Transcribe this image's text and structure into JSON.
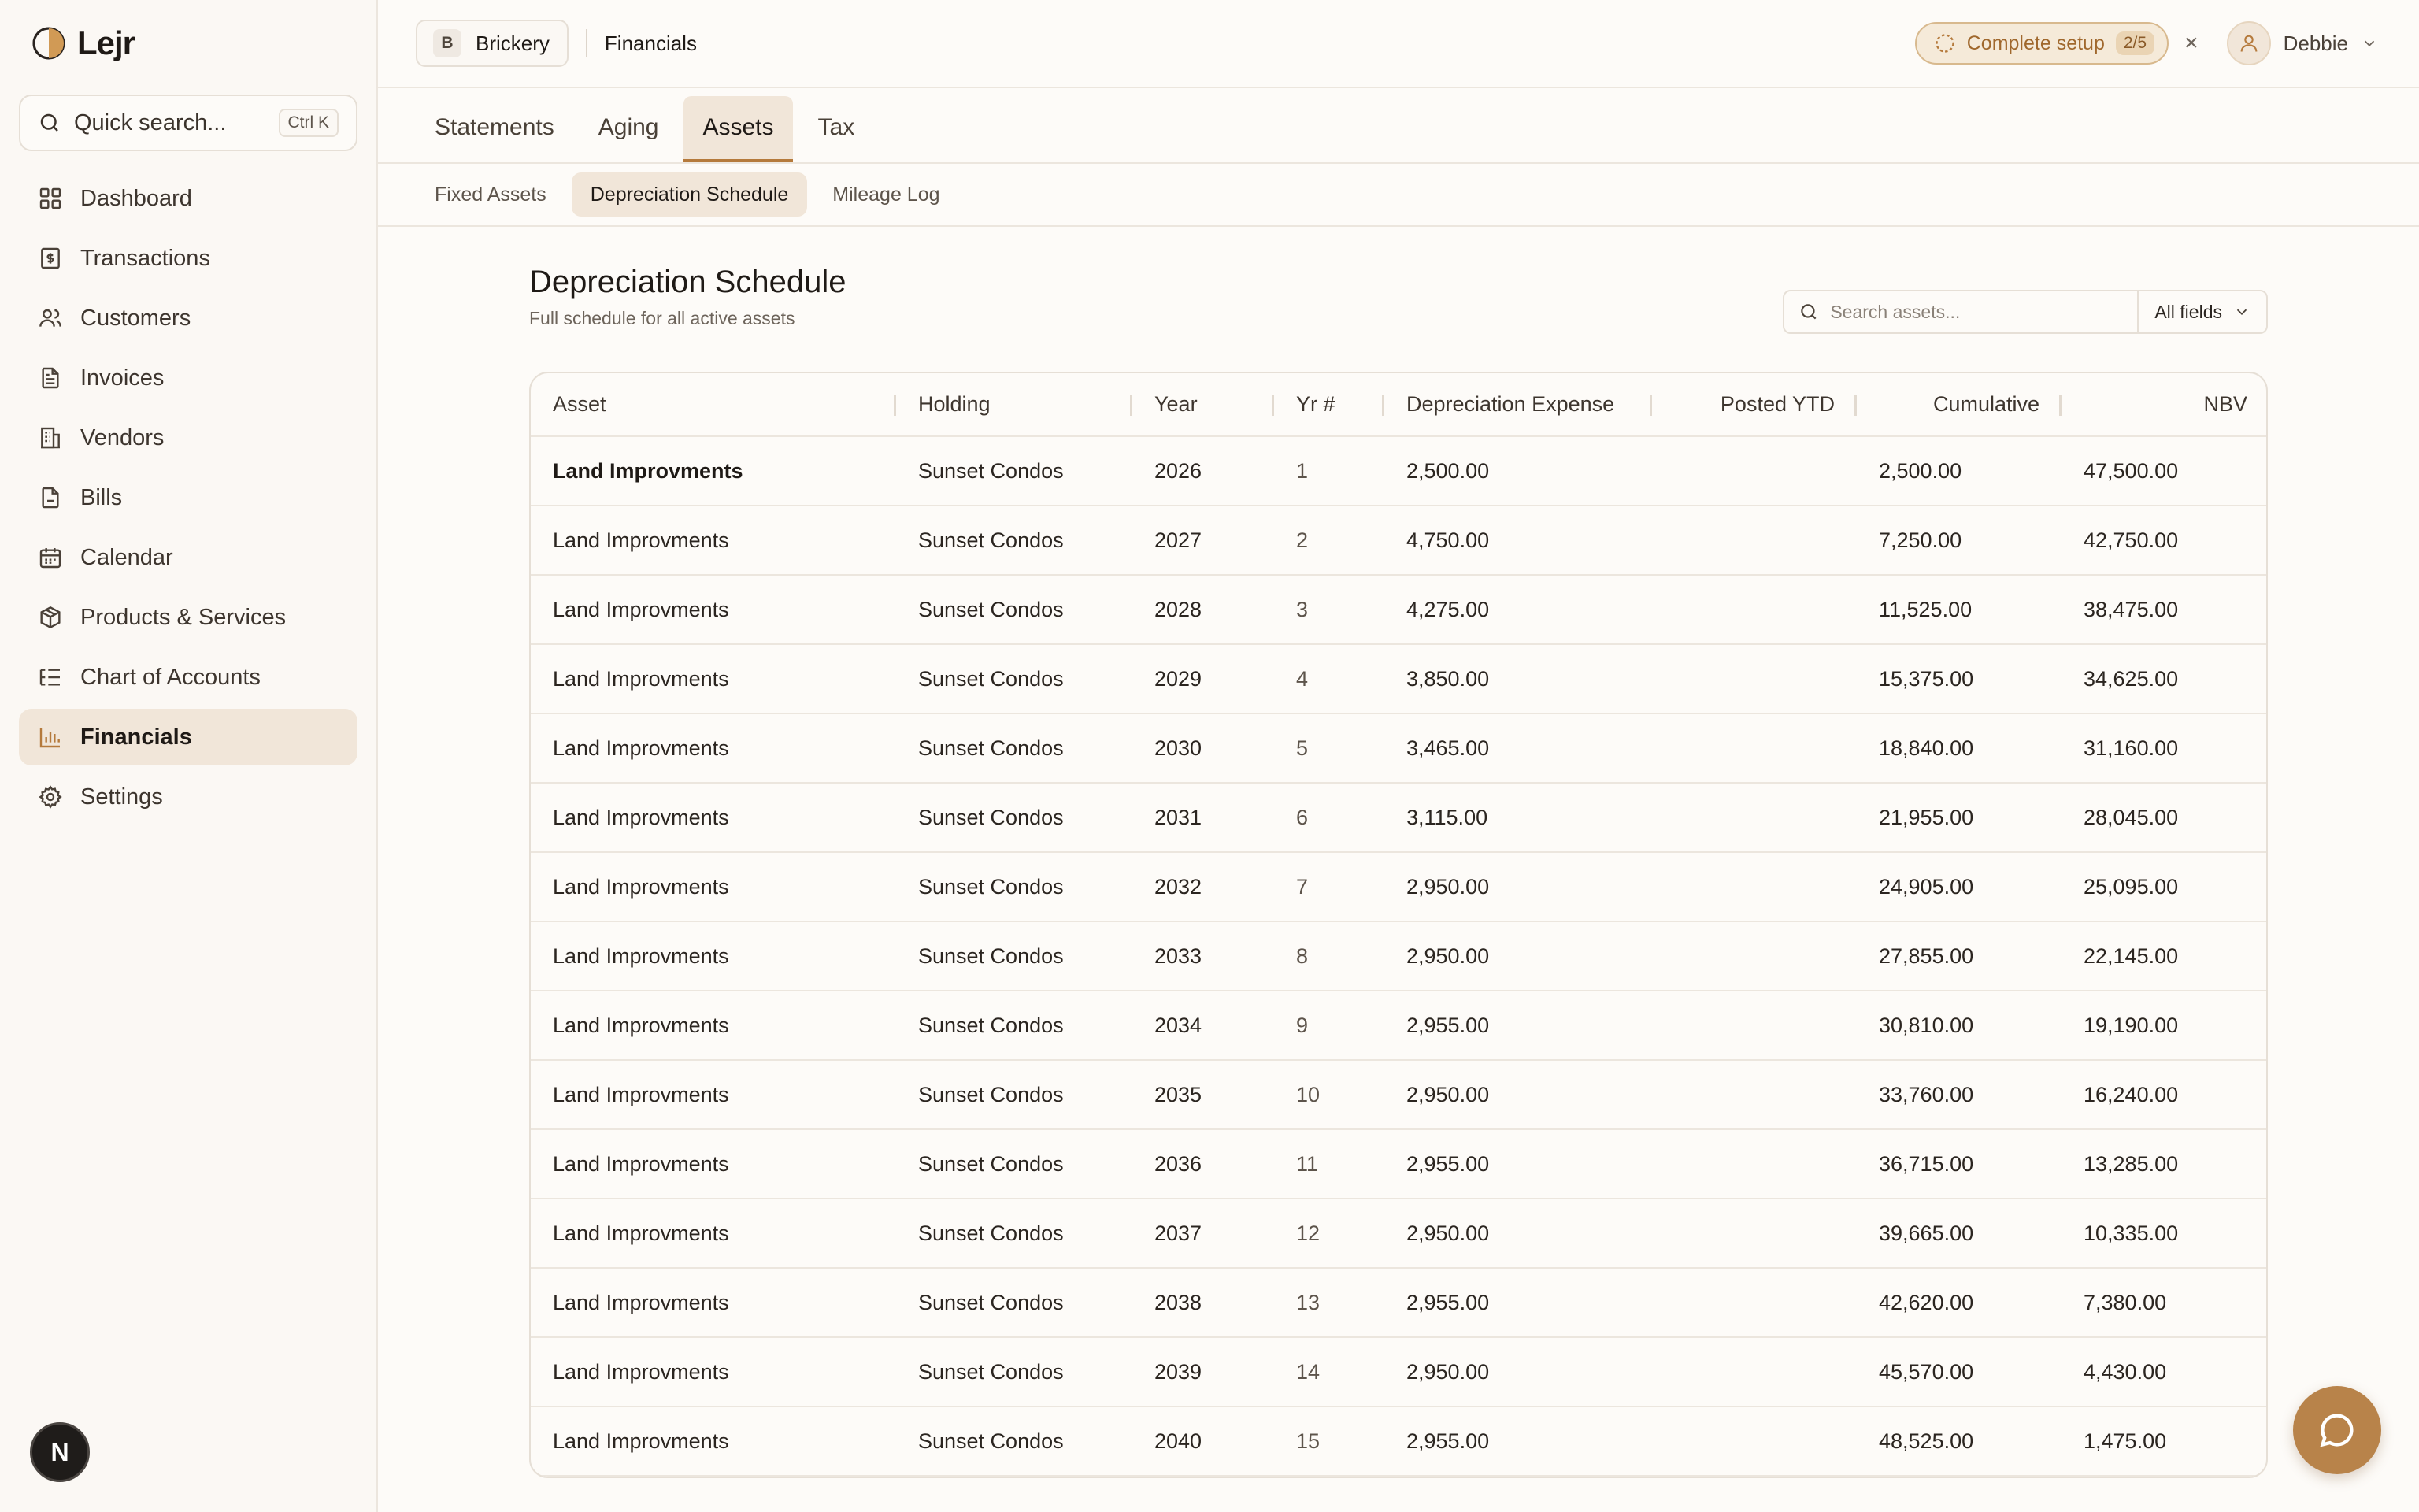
{
  "app": {
    "name": "Lejr",
    "accent": "#b57a3c"
  },
  "search": {
    "placeholder": "Quick search...",
    "shortcut": "Ctrl K"
  },
  "sidebar": {
    "items": [
      {
        "label": "Dashboard",
        "icon": "grid-icon"
      },
      {
        "label": "Transactions",
        "icon": "receipt-icon"
      },
      {
        "label": "Customers",
        "icon": "users-icon"
      },
      {
        "label": "Invoices",
        "icon": "file-text-icon"
      },
      {
        "label": "Vendors",
        "icon": "building-icon"
      },
      {
        "label": "Bills",
        "icon": "file-icon"
      },
      {
        "label": "Calendar",
        "icon": "calendar-icon"
      },
      {
        "label": "Products & Services",
        "icon": "box-icon"
      },
      {
        "label": "Chart of Accounts",
        "icon": "list-tree-icon"
      },
      {
        "label": "Financials",
        "icon": "bar-chart-icon",
        "active": true
      },
      {
        "label": "Settings",
        "icon": "gear-icon"
      }
    ],
    "bottom_avatar": "N"
  },
  "topbar": {
    "org_badge": "B",
    "org_name": "Brickery",
    "breadcrumb": "Financials",
    "setup_label": "Complete setup",
    "setup_count": "2/5",
    "close_glyph": "×",
    "user_name": "Debbie"
  },
  "tabs": [
    {
      "label": "Statements"
    },
    {
      "label": "Aging"
    },
    {
      "label": "Assets",
      "active": true
    },
    {
      "label": "Tax"
    }
  ],
  "subtabs": [
    {
      "label": "Fixed Assets"
    },
    {
      "label": "Depreciation Schedule",
      "active": true
    },
    {
      "label": "Mileage Log"
    }
  ],
  "page": {
    "title": "Depreciation Schedule",
    "subtitle": "Full schedule for all active assets",
    "search_placeholder": "Search assets...",
    "filter_value": "All fields"
  },
  "table": {
    "columns": [
      "Asset",
      "Holding",
      "Year",
      "Yr #",
      "Depreciation Expense",
      "Posted YTD",
      "Cumulative",
      "NBV"
    ],
    "rows": [
      [
        "Land Improvments",
        "Sunset Condos",
        "2026",
        "1",
        "2,500.00",
        "",
        "2,500.00",
        "47,500.00"
      ],
      [
        "Land Improvments",
        "Sunset Condos",
        "2027",
        "2",
        "4,750.00",
        "",
        "7,250.00",
        "42,750.00"
      ],
      [
        "Land Improvments",
        "Sunset Condos",
        "2028",
        "3",
        "4,275.00",
        "",
        "11,525.00",
        "38,475.00"
      ],
      [
        "Land Improvments",
        "Sunset Condos",
        "2029",
        "4",
        "3,850.00",
        "",
        "15,375.00",
        "34,625.00"
      ],
      [
        "Land Improvments",
        "Sunset Condos",
        "2030",
        "5",
        "3,465.00",
        "",
        "18,840.00",
        "31,160.00"
      ],
      [
        "Land Improvments",
        "Sunset Condos",
        "2031",
        "6",
        "3,115.00",
        "",
        "21,955.00",
        "28,045.00"
      ],
      [
        "Land Improvments",
        "Sunset Condos",
        "2032",
        "7",
        "2,950.00",
        "",
        "24,905.00",
        "25,095.00"
      ],
      [
        "Land Improvments",
        "Sunset Condos",
        "2033",
        "8",
        "2,950.00",
        "",
        "27,855.00",
        "22,145.00"
      ],
      [
        "Land Improvments",
        "Sunset Condos",
        "2034",
        "9",
        "2,955.00",
        "",
        "30,810.00",
        "19,190.00"
      ],
      [
        "Land Improvments",
        "Sunset Condos",
        "2035",
        "10",
        "2,950.00",
        "",
        "33,760.00",
        "16,240.00"
      ],
      [
        "Land Improvments",
        "Sunset Condos",
        "2036",
        "11",
        "2,955.00",
        "",
        "36,715.00",
        "13,285.00"
      ],
      [
        "Land Improvments",
        "Sunset Condos",
        "2037",
        "12",
        "2,950.00",
        "",
        "39,665.00",
        "10,335.00"
      ],
      [
        "Land Improvments",
        "Sunset Condos",
        "2038",
        "13",
        "2,955.00",
        "",
        "42,620.00",
        "7,380.00"
      ],
      [
        "Land Improvments",
        "Sunset Condos",
        "2039",
        "14",
        "2,950.00",
        "",
        "45,570.00",
        "4,430.00"
      ],
      [
        "Land Improvments",
        "Sunset Condos",
        "2040",
        "15",
        "2,955.00",
        "",
        "48,525.00",
        "1,475.00"
      ]
    ]
  }
}
